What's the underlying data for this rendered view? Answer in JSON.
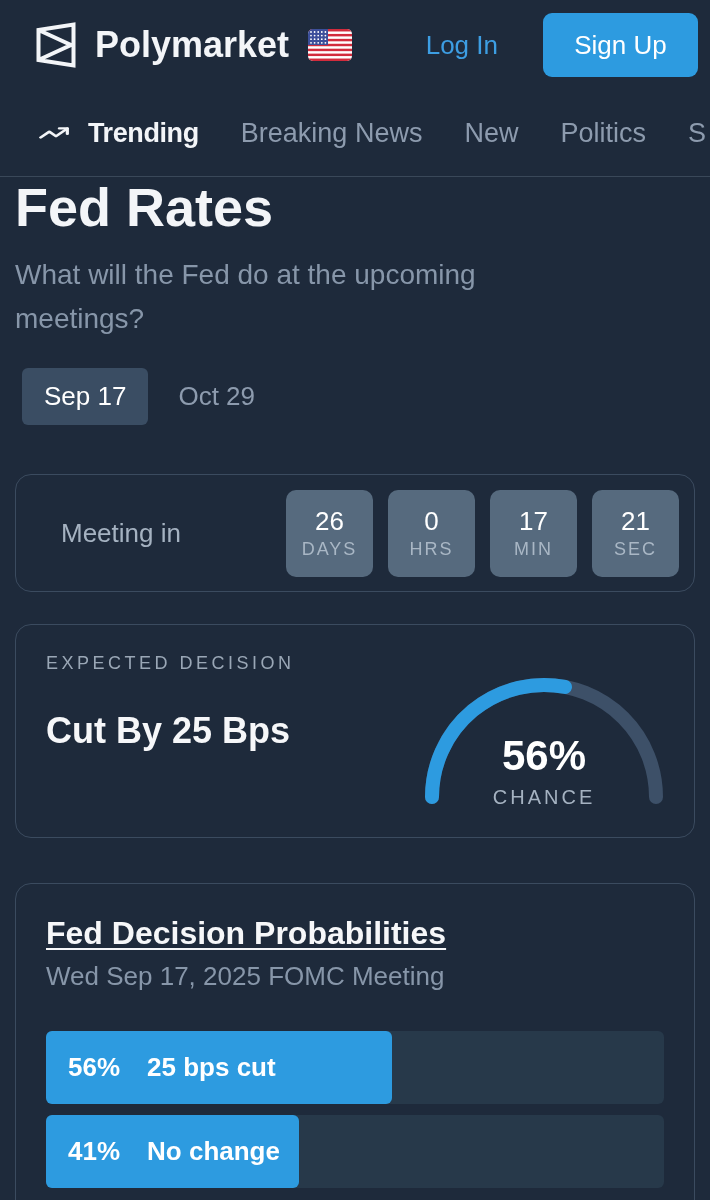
{
  "header": {
    "brand": "Polymarket",
    "login": "Log In",
    "signup": "Sign Up"
  },
  "nav": [
    {
      "label": "Trending",
      "kind": "iconed",
      "selected": true
    },
    {
      "label": "Breaking News",
      "kind": "plain",
      "selected": false
    },
    {
      "label": "New",
      "kind": "plain",
      "selected": false
    },
    {
      "label": "Politics",
      "kind": "plain",
      "selected": false
    },
    {
      "label": "S",
      "kind": "plain",
      "selected": false
    }
  ],
  "page": {
    "title": "Fed Rates",
    "subtitle": "What will the Fed do at the upcoming meetings?"
  },
  "meeting_tabs": [
    {
      "label": "Sep 17",
      "selected": true
    },
    {
      "label": "Oct 29",
      "selected": false
    }
  ],
  "countdown": {
    "label": "Meeting in",
    "units": [
      {
        "value": "26",
        "unit": "DAYS"
      },
      {
        "value": "0",
        "unit": "HRS"
      },
      {
        "value": "17",
        "unit": "MIN"
      },
      {
        "value": "21",
        "unit": "SEC"
      }
    ]
  },
  "expected_decision": {
    "label": "EXPECTED DECISION",
    "decision": "Cut By 25 Bps",
    "level": 0.56,
    "percent": "56%",
    "caption": "CHANCE"
  },
  "probabilities": {
    "title": "Fed Decision Probabilities",
    "subtitle": "Wed Sep 17, 2025 FOMC Meeting",
    "outcomes": [
      {
        "percent": "56%",
        "label": "25 bps cut",
        "level": 0.56
      },
      {
        "percent": "41%",
        "label": "No change",
        "level": 0.41
      }
    ]
  }
}
